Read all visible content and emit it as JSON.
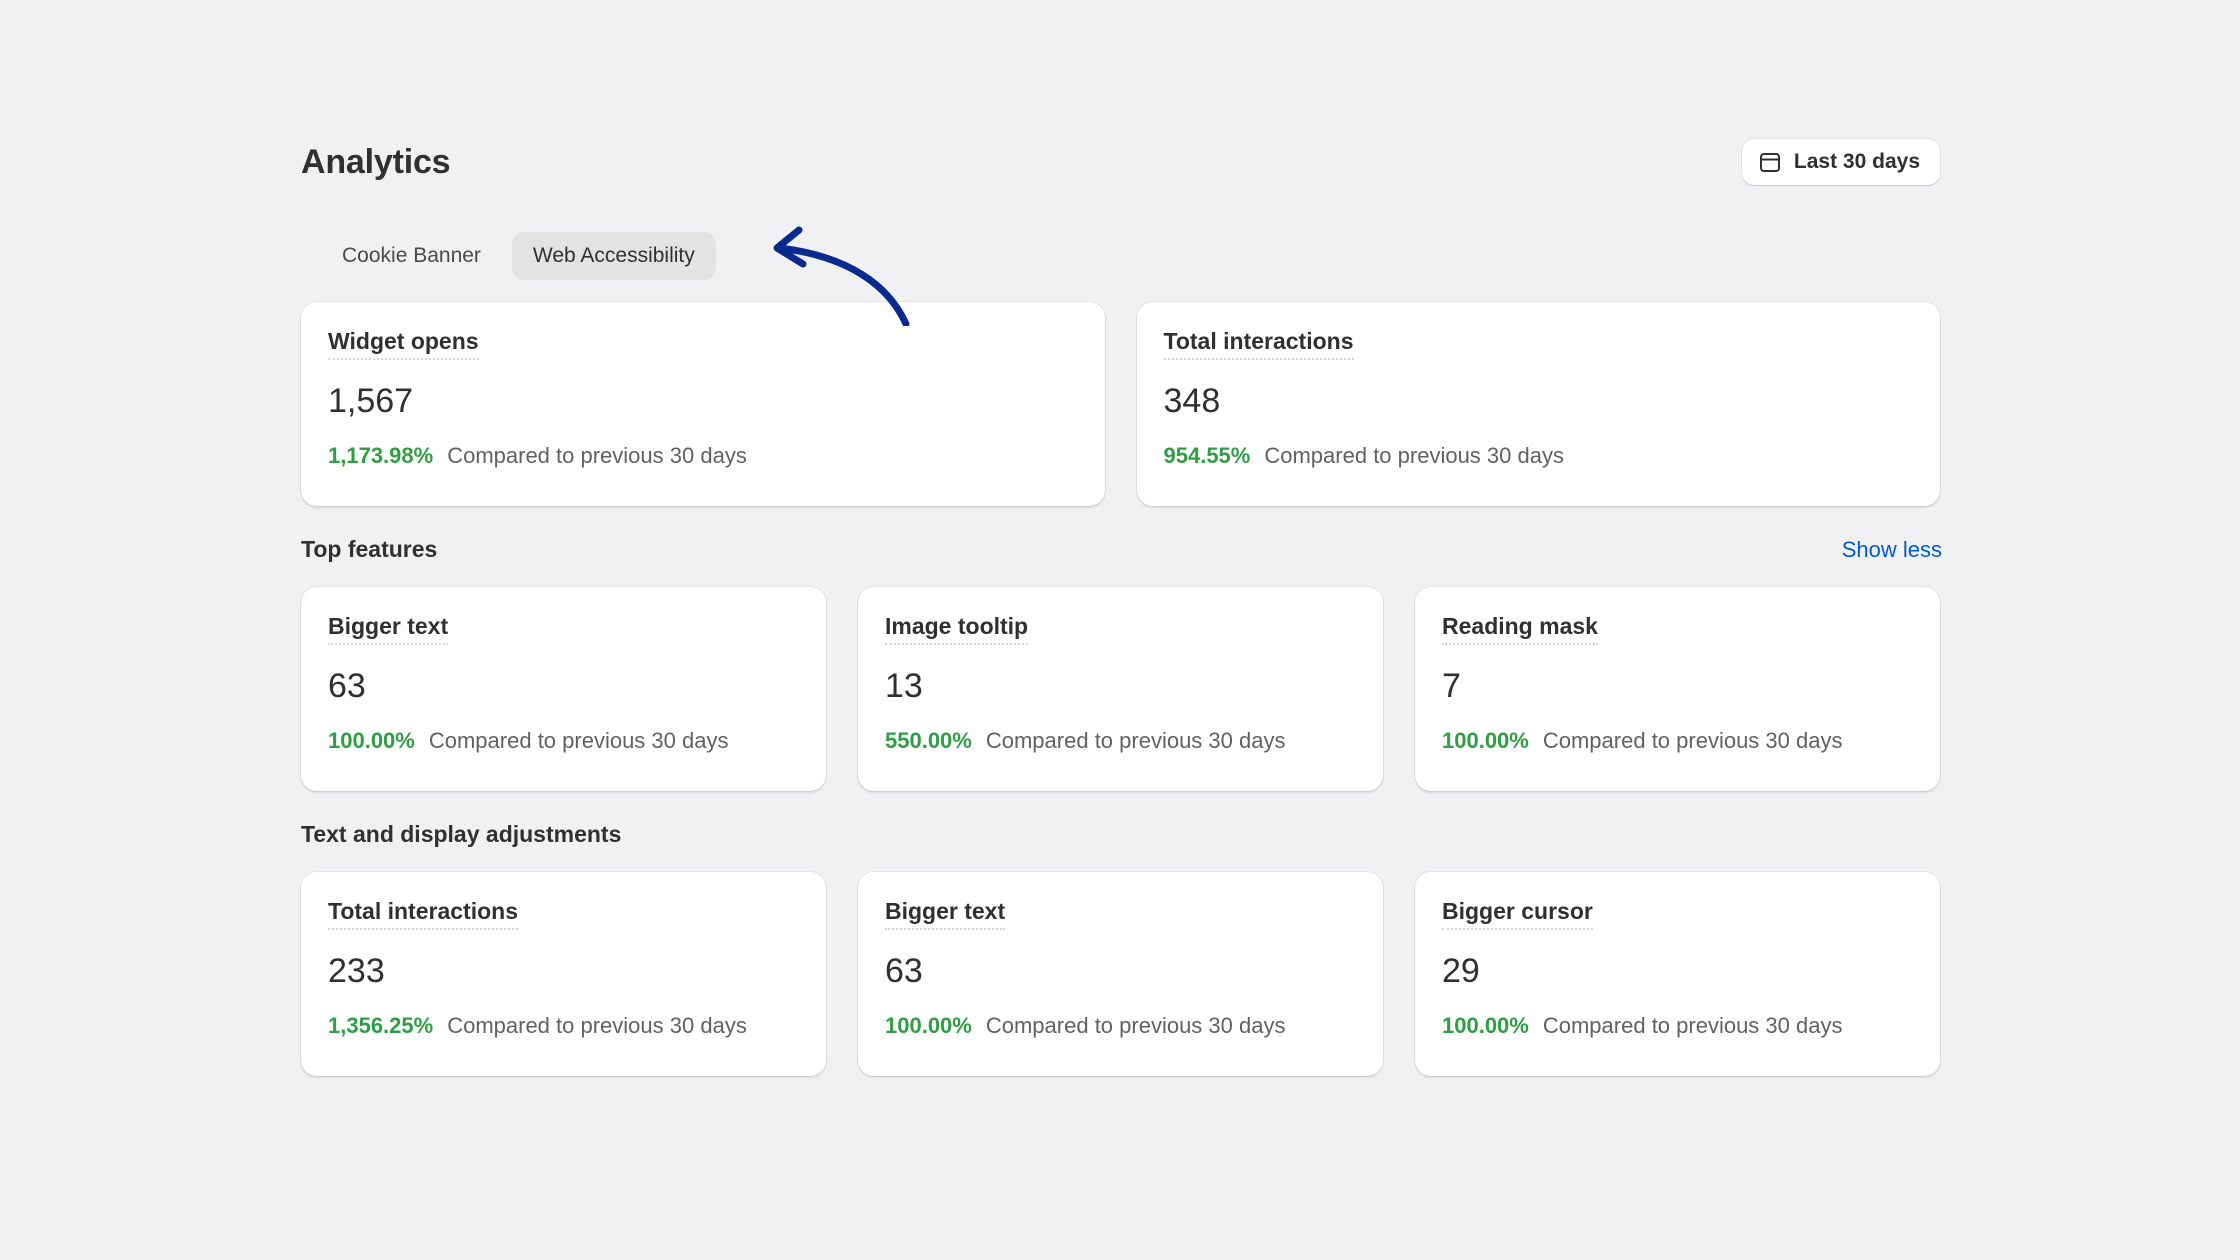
{
  "page": {
    "title": "Analytics",
    "date_range_label": "Last 30 days",
    "date_icon": "calendar-icon"
  },
  "tabs": [
    {
      "label": "Cookie Banner",
      "active": false
    },
    {
      "label": "Web Accessibility",
      "active": true
    }
  ],
  "annotation": {
    "icon": "curved-arrow-icon",
    "color": "#0b2a8f"
  },
  "summary": [
    {
      "title": "Widget opens",
      "value": "1,567",
      "change": "1,173.98%",
      "compare": "Compared to previous 30 days"
    },
    {
      "title": "Total interactions",
      "value": "348",
      "change": "954.55%",
      "compare": "Compared to previous 30 days"
    }
  ],
  "top_features": {
    "title": "Top features",
    "toggle_label": "Show less",
    "cards": [
      {
        "title": "Bigger text",
        "value": "63",
        "change": "100.00%",
        "compare": "Compared to previous 30 days"
      },
      {
        "title": "Image tooltip",
        "value": "13",
        "change": "550.00%",
        "compare": "Compared to previous 30 days"
      },
      {
        "title": "Reading mask",
        "value": "7",
        "change": "100.00%",
        "compare": "Compared to previous 30 days"
      }
    ]
  },
  "text_display": {
    "title": "Text and display adjustments",
    "cards": [
      {
        "title": "Total interactions",
        "value": "233",
        "change": "1,356.25%",
        "compare": "Compared to previous 30 days"
      },
      {
        "title": "Bigger text",
        "value": "63",
        "change": "100.00%",
        "compare": "Compared to previous 30 days"
      },
      {
        "title": "Bigger cursor",
        "value": "29",
        "change": "100.00%",
        "compare": "Compared to previous 30 days"
      }
    ]
  },
  "colors": {
    "background": "#f1f1f4",
    "positive": "#2f9e44",
    "link": "#005bd3"
  }
}
